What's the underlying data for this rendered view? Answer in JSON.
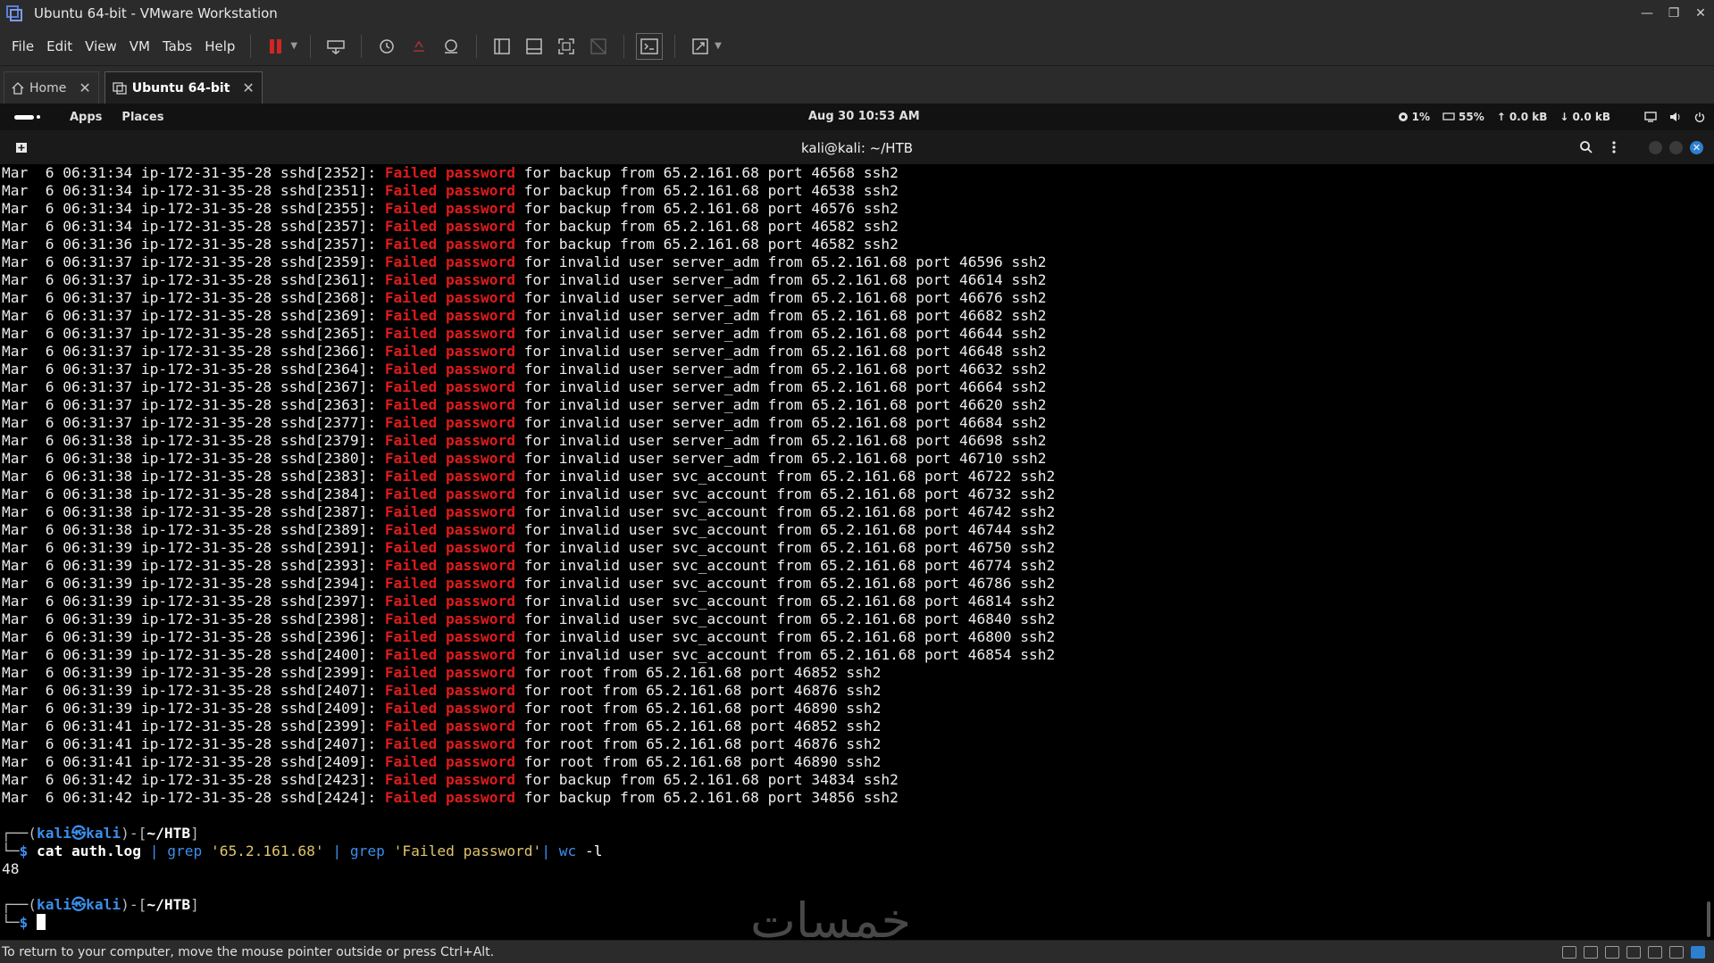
{
  "window": {
    "title": "Ubuntu 64-bit - VMware Workstation"
  },
  "menu": [
    "File",
    "Edit",
    "View",
    "VM",
    "Tabs",
    "Help"
  ],
  "tabs": [
    {
      "label": "Home",
      "active": false
    },
    {
      "label": "Ubuntu 64-bit",
      "active": true
    }
  ],
  "kali_panel": {
    "apps": "Apps",
    "places": "Places",
    "clock": "Aug 30  10:53 AM",
    "cpu": "1%",
    "mem": "55%",
    "up": "0.0 kB",
    "down": "0.0 kB"
  },
  "terminal": {
    "title": "kali@kali: ~/HTB",
    "log_lines": [
      {
        "pre": "Mar  6 06:31:34 ip-172-31-35-28 sshd[2352]: ",
        "fail": "Failed password",
        "post": " for backup from 65.2.161.68 port 46568 ssh2"
      },
      {
        "pre": "Mar  6 06:31:34 ip-172-31-35-28 sshd[2351]: ",
        "fail": "Failed password",
        "post": " for backup from 65.2.161.68 port 46538 ssh2"
      },
      {
        "pre": "Mar  6 06:31:34 ip-172-31-35-28 sshd[2355]: ",
        "fail": "Failed password",
        "post": " for backup from 65.2.161.68 port 46576 ssh2"
      },
      {
        "pre": "Mar  6 06:31:34 ip-172-31-35-28 sshd[2357]: ",
        "fail": "Failed password",
        "post": " for backup from 65.2.161.68 port 46582 ssh2"
      },
      {
        "pre": "Mar  6 06:31:36 ip-172-31-35-28 sshd[2357]: ",
        "fail": "Failed password",
        "post": " for backup from 65.2.161.68 port 46582 ssh2"
      },
      {
        "pre": "Mar  6 06:31:37 ip-172-31-35-28 sshd[2359]: ",
        "fail": "Failed password",
        "post": " for invalid user server_adm from 65.2.161.68 port 46596 ssh2"
      },
      {
        "pre": "Mar  6 06:31:37 ip-172-31-35-28 sshd[2361]: ",
        "fail": "Failed password",
        "post": " for invalid user server_adm from 65.2.161.68 port 46614 ssh2"
      },
      {
        "pre": "Mar  6 06:31:37 ip-172-31-35-28 sshd[2368]: ",
        "fail": "Failed password",
        "post": " for invalid user server_adm from 65.2.161.68 port 46676 ssh2"
      },
      {
        "pre": "Mar  6 06:31:37 ip-172-31-35-28 sshd[2369]: ",
        "fail": "Failed password",
        "post": " for invalid user server_adm from 65.2.161.68 port 46682 ssh2"
      },
      {
        "pre": "Mar  6 06:31:37 ip-172-31-35-28 sshd[2365]: ",
        "fail": "Failed password",
        "post": " for invalid user server_adm from 65.2.161.68 port 46644 ssh2"
      },
      {
        "pre": "Mar  6 06:31:37 ip-172-31-35-28 sshd[2366]: ",
        "fail": "Failed password",
        "post": " for invalid user server_adm from 65.2.161.68 port 46648 ssh2"
      },
      {
        "pre": "Mar  6 06:31:37 ip-172-31-35-28 sshd[2364]: ",
        "fail": "Failed password",
        "post": " for invalid user server_adm from 65.2.161.68 port 46632 ssh2"
      },
      {
        "pre": "Mar  6 06:31:37 ip-172-31-35-28 sshd[2367]: ",
        "fail": "Failed password",
        "post": " for invalid user server_adm from 65.2.161.68 port 46664 ssh2"
      },
      {
        "pre": "Mar  6 06:31:37 ip-172-31-35-28 sshd[2363]: ",
        "fail": "Failed password",
        "post": " for invalid user server_adm from 65.2.161.68 port 46620 ssh2"
      },
      {
        "pre": "Mar  6 06:31:37 ip-172-31-35-28 sshd[2377]: ",
        "fail": "Failed password",
        "post": " for invalid user server_adm from 65.2.161.68 port 46684 ssh2"
      },
      {
        "pre": "Mar  6 06:31:38 ip-172-31-35-28 sshd[2379]: ",
        "fail": "Failed password",
        "post": " for invalid user server_adm from 65.2.161.68 port 46698 ssh2"
      },
      {
        "pre": "Mar  6 06:31:38 ip-172-31-35-28 sshd[2380]: ",
        "fail": "Failed password",
        "post": " for invalid user server_adm from 65.2.161.68 port 46710 ssh2"
      },
      {
        "pre": "Mar  6 06:31:38 ip-172-31-35-28 sshd[2383]: ",
        "fail": "Failed password",
        "post": " for invalid user svc_account from 65.2.161.68 port 46722 ssh2"
      },
      {
        "pre": "Mar  6 06:31:38 ip-172-31-35-28 sshd[2384]: ",
        "fail": "Failed password",
        "post": " for invalid user svc_account from 65.2.161.68 port 46732 ssh2"
      },
      {
        "pre": "Mar  6 06:31:38 ip-172-31-35-28 sshd[2387]: ",
        "fail": "Failed password",
        "post": " for invalid user svc_account from 65.2.161.68 port 46742 ssh2"
      },
      {
        "pre": "Mar  6 06:31:38 ip-172-31-35-28 sshd[2389]: ",
        "fail": "Failed password",
        "post": " for invalid user svc_account from 65.2.161.68 port 46744 ssh2"
      },
      {
        "pre": "Mar  6 06:31:39 ip-172-31-35-28 sshd[2391]: ",
        "fail": "Failed password",
        "post": " for invalid user svc_account from 65.2.161.68 port 46750 ssh2"
      },
      {
        "pre": "Mar  6 06:31:39 ip-172-31-35-28 sshd[2393]: ",
        "fail": "Failed password",
        "post": " for invalid user svc_account from 65.2.161.68 port 46774 ssh2"
      },
      {
        "pre": "Mar  6 06:31:39 ip-172-31-35-28 sshd[2394]: ",
        "fail": "Failed password",
        "post": " for invalid user svc_account from 65.2.161.68 port 46786 ssh2"
      },
      {
        "pre": "Mar  6 06:31:39 ip-172-31-35-28 sshd[2397]: ",
        "fail": "Failed password",
        "post": " for invalid user svc_account from 65.2.161.68 port 46814 ssh2"
      },
      {
        "pre": "Mar  6 06:31:39 ip-172-31-35-28 sshd[2398]: ",
        "fail": "Failed password",
        "post": " for invalid user svc_account from 65.2.161.68 port 46840 ssh2"
      },
      {
        "pre": "Mar  6 06:31:39 ip-172-31-35-28 sshd[2396]: ",
        "fail": "Failed password",
        "post": " for invalid user svc_account from 65.2.161.68 port 46800 ssh2"
      },
      {
        "pre": "Mar  6 06:31:39 ip-172-31-35-28 sshd[2400]: ",
        "fail": "Failed password",
        "post": " for invalid user svc_account from 65.2.161.68 port 46854 ssh2"
      },
      {
        "pre": "Mar  6 06:31:39 ip-172-31-35-28 sshd[2399]: ",
        "fail": "Failed password",
        "post": " for root from 65.2.161.68 port 46852 ssh2"
      },
      {
        "pre": "Mar  6 06:31:39 ip-172-31-35-28 sshd[2407]: ",
        "fail": "Failed password",
        "post": " for root from 65.2.161.68 port 46876 ssh2"
      },
      {
        "pre": "Mar  6 06:31:39 ip-172-31-35-28 sshd[2409]: ",
        "fail": "Failed password",
        "post": " for root from 65.2.161.68 port 46890 ssh2"
      },
      {
        "pre": "Mar  6 06:31:41 ip-172-31-35-28 sshd[2399]: ",
        "fail": "Failed password",
        "post": " for root from 65.2.161.68 port 46852 ssh2"
      },
      {
        "pre": "Mar  6 06:31:41 ip-172-31-35-28 sshd[2407]: ",
        "fail": "Failed password",
        "post": " for root from 65.2.161.68 port 46876 ssh2"
      },
      {
        "pre": "Mar  6 06:31:41 ip-172-31-35-28 sshd[2409]: ",
        "fail": "Failed password",
        "post": " for root from 65.2.161.68 port 46890 ssh2"
      },
      {
        "pre": "Mar  6 06:31:42 ip-172-31-35-28 sshd[2423]: ",
        "fail": "Failed password",
        "post": " for backup from 65.2.161.68 port 34834 ssh2"
      },
      {
        "pre": "Mar  6 06:31:42 ip-172-31-35-28 sshd[2424]: ",
        "fail": "Failed password",
        "post": " for backup from 65.2.161.68 port 34856 ssh2"
      }
    ],
    "prompt": {
      "box_top": "┌──(",
      "user": "kali㉿kali",
      "mid": ")-[",
      "dir": "~/HTB",
      "end": "]",
      "box_bottom": "└─",
      "dollar": "$ "
    },
    "command": {
      "cat": "cat",
      "file": " auth.log ",
      "pipe1": "| grep",
      "arg1": " '65.2.161.68' ",
      "pipe2": "| grep",
      "arg2": " 'Failed password'",
      "pipe3": "| wc",
      "arg3": " -l"
    },
    "output": "48"
  },
  "statusbar": {
    "message": "To return to your computer, move the mouse pointer outside or press Ctrl+Alt."
  },
  "watermark": "خمسات",
  "colors": {
    "fail_red": "#e01b1b",
    "prompt_blue": "#3b8eea",
    "string_yellow": "#e0c46c"
  }
}
